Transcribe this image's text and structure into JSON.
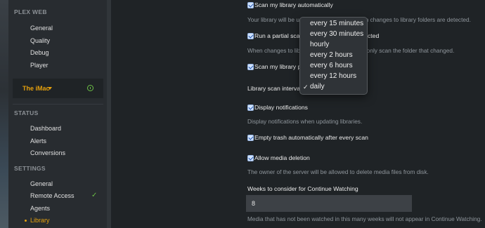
{
  "sidebar": {
    "plex_web_header": "PLEX WEB",
    "plex_web_items": [
      "General",
      "Quality",
      "Debug",
      "Player"
    ],
    "server": {
      "name": "The iMac",
      "status_icon": "power-on-icon"
    },
    "status_header": "STATUS",
    "status_items": [
      "Dashboard",
      "Alerts",
      "Conversions"
    ],
    "settings_header": "SETTINGS",
    "settings_items": [
      "General",
      "Remote Access",
      "Agents",
      "Library"
    ],
    "active_item": "Library",
    "remote_access_check": "✓"
  },
  "settings": {
    "scan_auto": {
      "label": "Scan my library automatically",
      "checked": true
    },
    "scan_auto_desc": "Your library will be updated automatically when changes to library folders are detected.",
    "partial_scan": {
      "label": "Run a partial scan when changes are detected",
      "checked": true
    },
    "partial_scan_desc": "When changes to library folders are detected, only scan the folder that changed.",
    "scan_periodic": {
      "label": "Scan my library periodically",
      "checked": true
    },
    "interval_label": "Library scan interval",
    "display_notifications": {
      "label": "Display notifications",
      "checked": true
    },
    "display_notifications_desc": "Display notifications when updating libraries.",
    "empty_trash": {
      "label": "Empty trash automatically after every scan",
      "checked": true
    },
    "allow_deletion": {
      "label": "Allow media deletion",
      "checked": true
    },
    "allow_deletion_desc": "The owner of the server will be allowed to delete media files from disk.",
    "weeks_label": "Weeks to consider for Continue Watching",
    "weeks_value": "8",
    "weeks_desc": "Media that has not been watched in this many weeks will not appear in Continue Watching."
  },
  "interval_menu": {
    "options": [
      "every 15 minutes",
      "every 30 minutes",
      "hourly",
      "every 2 hours",
      "every 6 hours",
      "every 12 hours",
      "daily"
    ],
    "selected": "daily",
    "check_glyph": "✓"
  },
  "colors": {
    "accent": "#e5a00d",
    "success": "#6bbd45",
    "background": "#1f2326",
    "sidebar": "#282c30"
  }
}
